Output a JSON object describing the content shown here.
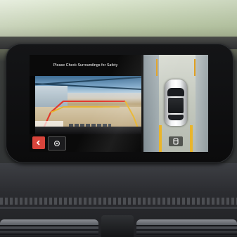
{
  "display": {
    "title": "Please Check Surroundings for Safety"
  },
  "controls": {
    "back_button_icon": "back-arrow-icon",
    "camera_toggle_icon": "camera-view-icon",
    "top_view_icon": "car-top-view-icon"
  },
  "colors": {
    "back_button": "#d8443b",
    "guide_line_red": "#e23a2e",
    "guide_line_yellow": "#e9b52b"
  }
}
